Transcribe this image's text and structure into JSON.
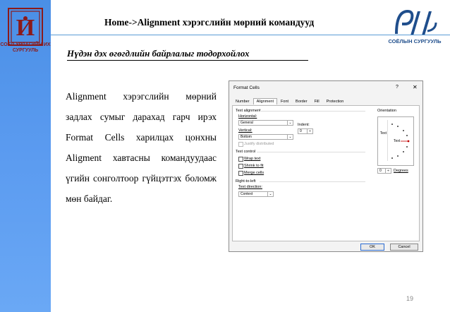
{
  "slide": {
    "title": "Home->Alignment хэрэгслийн мөрний командууд",
    "subtitle": "Нүдэн дэх өгөгдлийн байрлалыг тодорхойлох",
    "body_text": "Alignment хэрэгслийн мөрний задлах сумыг дарахад гарч ирэх Format Cells харилцах цонхны Aligment хавтасны командуудаас үгийн сонголтоор гүйцэтгэх боломж мөн байдаг.",
    "page_number": "19",
    "left_logo_text": "СОЁЛ УРЛАГИЙН ИХ СУРГУУЛЬ",
    "right_logo_text": "СОЁЛЫН СУРГУУЛЬ"
  },
  "dialog": {
    "title": "Format Cells",
    "help": "?",
    "close": "✕",
    "tabs": [
      "Number",
      "Alignment",
      "Font",
      "Border",
      "Fill",
      "Protection"
    ],
    "active_tab": "Alignment",
    "text_alignment_heading": "Text alignment",
    "horizontal_label": "Horizontal:",
    "horizontal_value": "General",
    "indent_label": "Indent:",
    "indent_value": "0",
    "vertical_label": "Vertical:",
    "vertical_value": "Bottom",
    "justify_distributed": "Justify distributed",
    "text_control_heading": "Text control",
    "wrap_text": "Wrap text",
    "shrink_to_fit": "Shrink to fit",
    "merge_cells": "Merge cells",
    "rtl_heading": "Right-to-left",
    "text_direction_label": "Text direction:",
    "text_direction_value": "Context",
    "orientation_heading": "Orientation",
    "orientation_vertical_text": "Text",
    "orientation_text": "Text",
    "degrees_value": "0",
    "degrees_label": "Degrees",
    "ok": "OK",
    "cancel": "Cancel"
  },
  "colors": {
    "left_bar": "#5b9bf0",
    "left_logo": "#8b1a1a",
    "right_logo": "#1f4e8c",
    "rule": "#5b9bd5"
  },
  "icons": [
    "left-institution-logo-icon",
    "right-institution-logo-icon",
    "dropdown-arrow-icon",
    "orientation-dial-icon"
  ]
}
